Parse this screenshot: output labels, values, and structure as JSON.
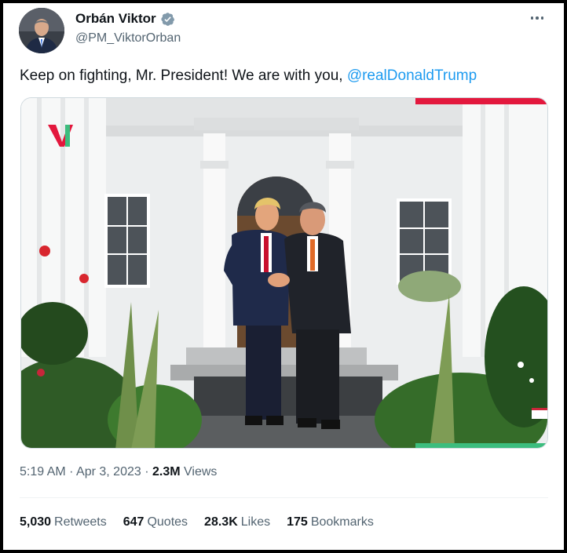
{
  "author": {
    "name": "Orbán Viktor",
    "handle": "@PM_ViktorOrban",
    "verified": true,
    "accent_color": "#829aab"
  },
  "tweet": {
    "text": "Keep on fighting, Mr. President! We are with you, ",
    "mention": "@realDonaldTrump"
  },
  "meta": {
    "time": "5:19 AM",
    "sep1": " · ",
    "date": "Apr 3, 2023",
    "sep2": " · ",
    "views_count": "2.3M",
    "views_label": " Views"
  },
  "stats": [
    {
      "count": "5,030",
      "label": "Retweets"
    },
    {
      "count": "647",
      "label": "Quotes"
    },
    {
      "count": "28.3K",
      "label": "Likes"
    },
    {
      "count": "175",
      "label": "Bookmarks"
    }
  ],
  "icons": {
    "more": "more-icon",
    "verified": "verified-badge-icon"
  },
  "colors": {
    "mention": "#1d9bf0",
    "secondary_text": "#536471",
    "brand_red": "#e3183d",
    "brand_green": "#3cbd7e"
  }
}
